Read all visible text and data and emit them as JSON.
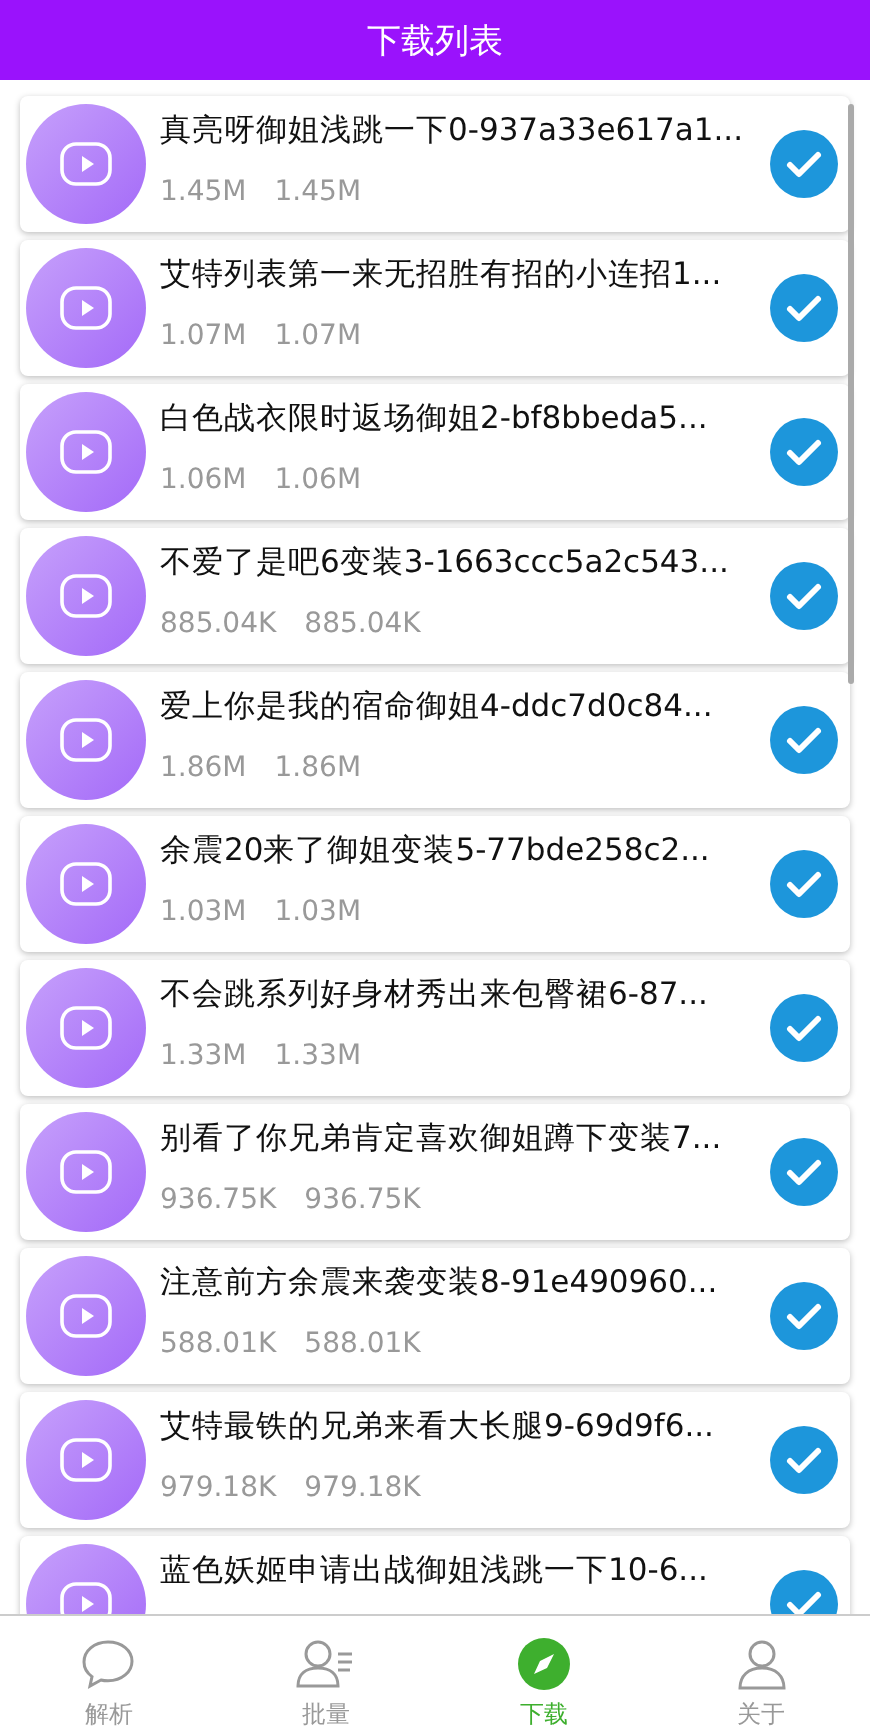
{
  "header": {
    "title": "下载列表"
  },
  "downloads": [
    {
      "title": "真亮呀御姐浅跳一下0-937a33e617a1...",
      "size": "1.45M",
      "downloaded": "1.45M",
      "checked": true
    },
    {
      "title": "艾特列表第一来无招胜有招的小连招1...",
      "size": "1.07M",
      "downloaded": "1.07M",
      "checked": true
    },
    {
      "title": "白色战衣限时返场御姐2-bf8bbeda5...",
      "size": "1.06M",
      "downloaded": "1.06M",
      "checked": true
    },
    {
      "title": "不爱了是吧6变装3-1663ccc5a2c543...",
      "size": "885.04K",
      "downloaded": "885.04K",
      "checked": true
    },
    {
      "title": "爱上你是我的宿命御姐4-ddc7d0c84...",
      "size": "1.86M",
      "downloaded": "1.86M",
      "checked": true
    },
    {
      "title": "余震20来了御姐变装5-77bde258c2...",
      "size": "1.03M",
      "downloaded": "1.03M",
      "checked": true
    },
    {
      "title": "不会跳系列好身材秀出来包臀裙6-87...",
      "size": "1.33M",
      "downloaded": "1.33M",
      "checked": true
    },
    {
      "title": "别看了你兄弟肯定喜欢御姐蹲下变装7...",
      "size": "936.75K",
      "downloaded": "936.75K",
      "checked": true
    },
    {
      "title": "注意前方余震来袭变装8-91e490960...",
      "size": "588.01K",
      "downloaded": "588.01K",
      "checked": true
    },
    {
      "title": "艾特最铁的兄弟来看大长腿9-69d9f6...",
      "size": "979.18K",
      "downloaded": "979.18K",
      "checked": true
    },
    {
      "title": "蓝色妖姬申请出战御姐浅跳一下10-6...",
      "checked": true
    }
  ],
  "tab_bar": [
    {
      "kind": "chat",
      "label": "解析",
      "selected": false
    },
    {
      "kind": "users",
      "label": "批量",
      "selected": false
    },
    {
      "kind": "compass",
      "label": "下载",
      "selected": true
    },
    {
      "kind": "user",
      "label": "关于",
      "selected": false
    }
  ]
}
